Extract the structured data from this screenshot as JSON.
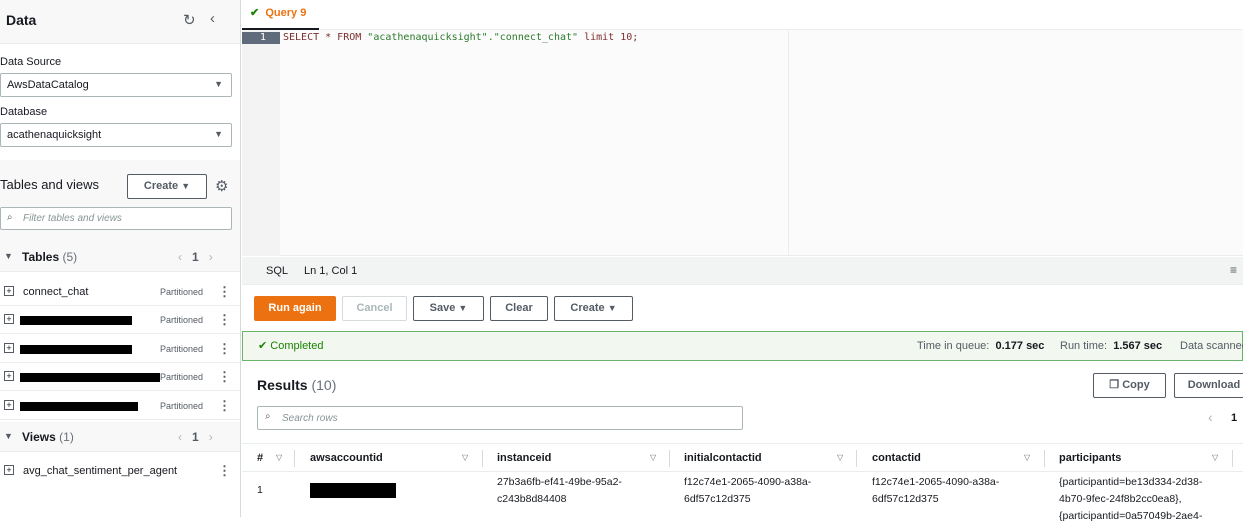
{
  "sidebar": {
    "title": "Data",
    "data_source_label": "Data Source",
    "data_source_value": "AwsDataCatalog",
    "database_label": "Database",
    "database_value": "acathenaquicksight",
    "tables_views_title": "Tables and views",
    "create_label": "Create",
    "filter_placeholder": "Filter tables and views",
    "tables_label": "Tables",
    "tables_count": "(5)",
    "tables_page": "1",
    "tables": [
      {
        "name": "connect_chat",
        "badge": "Partitioned"
      },
      {
        "name": "",
        "badge": "Partitioned"
      },
      {
        "name": "",
        "badge": "Partitioned"
      },
      {
        "name": "",
        "badge": "Partitioned"
      },
      {
        "name": "",
        "badge": "Partitioned"
      }
    ],
    "views_label": "Views",
    "views_count": "(1)",
    "views_page": "1",
    "views": [
      {
        "name": "avg_chat_sentiment_per_agent"
      }
    ]
  },
  "editor": {
    "tab_label": "Query 9",
    "line_number": "1",
    "code_kw1": "SELECT * FROM ",
    "code_s1": "\"acathenaquicksight\"",
    "code_dot": ".",
    "code_s2": "\"connect_chat\"",
    "code_tail": " limit 10;",
    "language": "SQL",
    "cursor": "Ln 1, Col 1"
  },
  "toolbar": {
    "run_again": "Run again",
    "cancel": "Cancel",
    "save": "Save",
    "clear": "Clear",
    "create": "Create"
  },
  "status": {
    "state": "Completed",
    "queue_label": "Time in queue:",
    "queue_value": "0.177 sec",
    "runtime_label": "Run time:",
    "runtime_value": "1.567 sec",
    "scanned_label": "Data scanned"
  },
  "results": {
    "title": "Results",
    "count": "(10)",
    "copy": "Copy",
    "download": "Download",
    "search_placeholder": "Search rows",
    "page": "1",
    "columns": [
      "#",
      "awsaccountid",
      "instanceid",
      "initialcontactid",
      "contactid",
      "participants"
    ],
    "rows": [
      {
        "num": "1",
        "awsaccountid": "",
        "instanceid": "27b3a6fb-ef41-49be-95a2-c243b8d84408",
        "initialcontactid": "f12c74e1-2065-4090-a38a-6df57c12d375",
        "contactid": "f12c74e1-2065-4090-a38a-6df57c12d375",
        "participants": "{participantid=be13d334-2d38-4b70-9fec-24f8b2cc0ea8}, {participantid=0a57049b-2ae4-"
      }
    ]
  },
  "colors": {
    "accent": "#ec7211",
    "success": "#1d8102",
    "gutter_active": "#5f6b7a"
  }
}
